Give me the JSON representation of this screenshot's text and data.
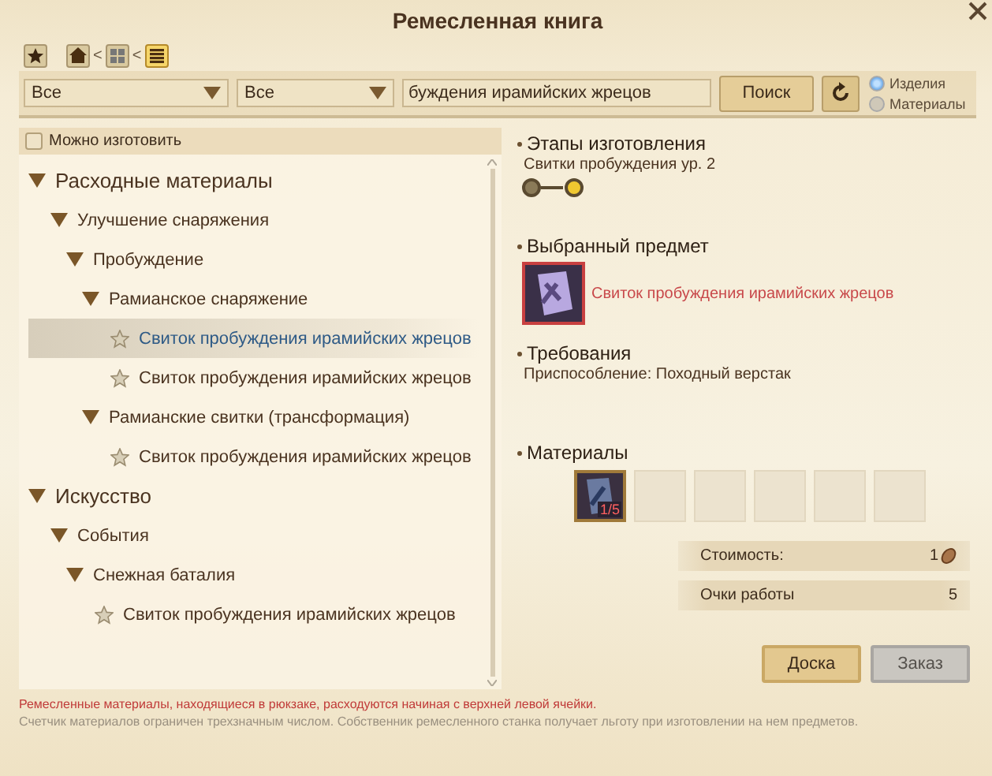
{
  "window": {
    "title": "Ремесленная книга"
  },
  "breadcrumb": [
    {
      "kind": "home",
      "selected": false
    },
    {
      "kind": "grid",
      "selected": false
    },
    {
      "kind": "list",
      "selected": true
    }
  ],
  "breadcrumb_separators": [
    "<",
    "<"
  ],
  "filters": {
    "dropdowns": [
      {
        "value": "Все"
      },
      {
        "value": "Все"
      }
    ],
    "search": {
      "value": "буждения ирамийских жрецов"
    },
    "search_button": "Поиск",
    "modes": [
      {
        "label": "Изделия",
        "selected": true
      },
      {
        "label": "Материалы",
        "selected": false
      }
    ]
  },
  "craftable_filter": {
    "label": "Можно изготовить",
    "checked": false
  },
  "tree": [
    {
      "kind": "category",
      "label": "Расходные материалы",
      "expanded": true,
      "children": [
        {
          "kind": "category",
          "label": "Улучшение снаряжения",
          "expanded": true,
          "children": [
            {
              "kind": "category",
              "label": "Пробуждение",
              "expanded": true,
              "children": [
                {
                  "kind": "category",
                  "label": "Рамианское снаряжение",
                  "expanded": true,
                  "children": [
                    {
                      "kind": "recipe",
                      "label": "Свиток пробуждения ирамийских жрецов",
                      "selected": true
                    },
                    {
                      "kind": "recipe",
                      "label": "Свиток пробуждения ирамийских жрецов",
                      "selected": false
                    }
                  ]
                },
                {
                  "kind": "category",
                  "label": "Рамианские свитки (трансформация)",
                  "expanded": true,
                  "children": [
                    {
                      "kind": "recipe",
                      "label": "Свиток пробуждения ирамийских жрецов",
                      "selected": false
                    }
                  ]
                }
              ]
            }
          ]
        }
      ]
    },
    {
      "kind": "category",
      "label": "Искусство",
      "expanded": true,
      "children": [
        {
          "kind": "category",
          "label": "События",
          "expanded": true,
          "children": [
            {
              "kind": "category",
              "label": "Снежная баталия",
              "expanded": true,
              "children": [
                {
                  "kind": "recipe",
                  "label": "Свиток пробуждения ирамийских жрецов",
                  "selected": false
                }
              ]
            }
          ]
        }
      ]
    }
  ],
  "stages": {
    "heading": "Этапы изготовления",
    "name": "Свитки пробуждения ур. 2",
    "steps": [
      {
        "current": false
      },
      {
        "current": true
      }
    ]
  },
  "selected_item": {
    "heading": "Выбранный предмет",
    "name": "Свиток пробуждения ирамийских жрецов"
  },
  "requirements": {
    "heading": "Требования",
    "text": "Приспособление: Походный верстак"
  },
  "materials": {
    "heading": "Материалы",
    "slots": [
      {
        "kind": "item",
        "count": "1/5"
      },
      {
        "kind": "empty"
      },
      {
        "kind": "empty"
      },
      {
        "kind": "empty"
      },
      {
        "kind": "empty"
      },
      {
        "kind": "empty"
      }
    ]
  },
  "stats": [
    {
      "kind": "cost",
      "label": "Стоимость:",
      "value": "1"
    },
    {
      "kind": "plain",
      "label": "Очки работы",
      "value": "5"
    }
  ],
  "buttons": [
    {
      "label": "Доска",
      "disabled": false
    },
    {
      "label": "Заказ",
      "disabled": true
    }
  ],
  "footer": [
    {
      "kind": "warning",
      "text": "Ремесленные материалы, находящиеся в рюкзаке, расходуются начиная с верхней левой ячейки."
    },
    {
      "kind": "note",
      "text": "Счетчик материалов ограничен трехзначным числом. Собственник ремесленного станка получает льготу при изготовлении на нем предметов."
    }
  ]
}
